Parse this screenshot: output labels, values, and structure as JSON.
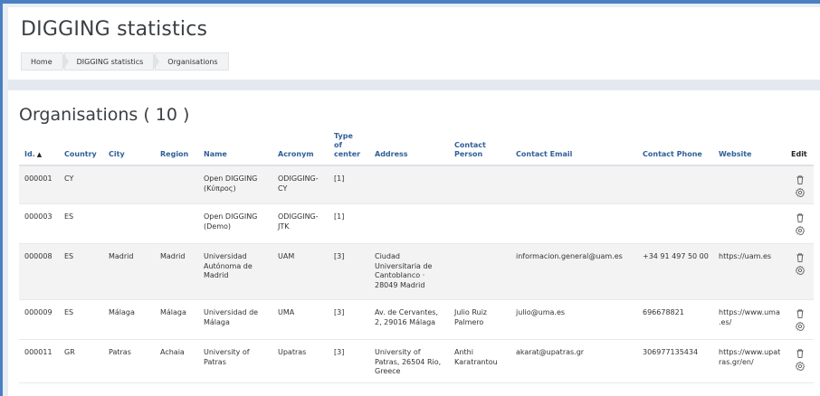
{
  "header": {
    "title": "DIGGING statistics",
    "breadcrumb": [
      "Home",
      "DIGGING statistics",
      "Organisations"
    ]
  },
  "section": {
    "title": "Organisations ( 10 )"
  },
  "table": {
    "columns": {
      "id": "Id.",
      "country": "Country",
      "city": "City",
      "region": "Region",
      "name": "Name",
      "acronym": "Acronym",
      "type_l1": "Type",
      "type_l2": "of",
      "type_l3": "center",
      "address": "Address",
      "contact_l1": "Contact",
      "contact_l2": "Person",
      "email": "Contact Email",
      "phone": "Contact Phone",
      "website": "Website",
      "edit": "Edit"
    },
    "sort": {
      "column": "id",
      "direction": "ascending",
      "icon": "sort-ascending-icon"
    },
    "rows": [
      {
        "id": "000001",
        "country": "CY",
        "city": "",
        "region": "",
        "name": "Open DIGGING (Κύπρος)",
        "acronym": "ODIGGING-CY",
        "type": "[1]",
        "address": "",
        "contact": "",
        "email": "",
        "phone": "",
        "website": ""
      },
      {
        "id": "000003",
        "country": "ES",
        "city": "",
        "region": "",
        "name": "Open DIGGING (Demo)",
        "acronym": "ODIGGING-JTK",
        "type": "[1]",
        "address": "",
        "contact": "",
        "email": "",
        "phone": "",
        "website": ""
      },
      {
        "id": "000008",
        "country": "ES",
        "city": "Madrid",
        "region": "Madrid",
        "name": "Universidad Autónoma de Madrid",
        "acronym": "UAM",
        "type": "[3]",
        "address": "Ciudad Universitaria de Cantoblanco · 28049 Madrid",
        "contact": "",
        "email": "informacion.general@uam.es",
        "phone": "+34 91 497 50 00",
        "website": "https://uam.es"
      },
      {
        "id": "000009",
        "country": "ES",
        "city": "Málaga",
        "region": "Málaga",
        "name": "Universidad de Málaga",
        "acronym": "UMA",
        "type": "[3]",
        "address": "Av. de Cervantes, 2, 29016 Málaga",
        "contact": "Julio Ruiz Palmero",
        "email": "julio@uma.es",
        "phone": "696678821",
        "website": "https://www.uma.es/"
      },
      {
        "id": "000011",
        "country": "GR",
        "city": "Patras",
        "region": "Achaia",
        "name": "University of Patras",
        "acronym": "Upatras",
        "type": "[3]",
        "address": "University of Patras, 26504 Rio, Greece",
        "contact": "Anthi Karatrantou",
        "email": "akarat@upatras.gr",
        "phone": "306977135434",
        "website": "https://www.upatras.gr/en/"
      }
    ],
    "row_icons": [
      "trash-icon",
      "settings-gear-icon"
    ]
  },
  "colors": {
    "accent_border": "#4a7fc1",
    "header_link": "#2e5f98",
    "page_background": "#e9eef3",
    "row_stripe": "#f3f3f3"
  }
}
